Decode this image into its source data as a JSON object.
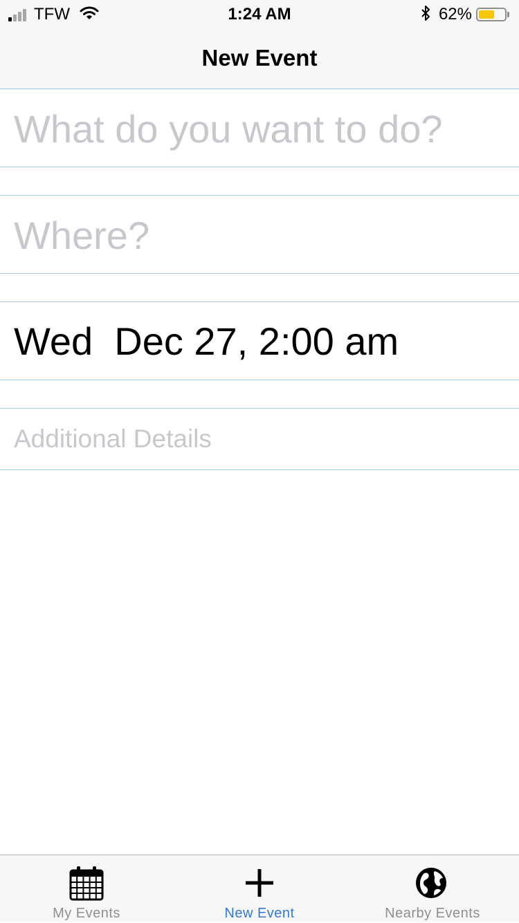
{
  "colors": {
    "accent": "#3478d6",
    "inactive": "#8e8e93",
    "placeholder": "#c7c7cd",
    "separator": "#9fd0e6",
    "battery": "#f6c60d",
    "bars_bg": "#f7f7f7"
  },
  "status_bar": {
    "carrier": "TFW",
    "time": "1:24 AM",
    "battery_percent": "62%",
    "battery_level": 0.62,
    "signal_bars_filled": 1,
    "signal_bars_total": 4,
    "icons": [
      "signal-icon",
      "wifi-icon",
      "bluetooth-icon",
      "battery-icon"
    ]
  },
  "nav": {
    "title": "New Event"
  },
  "form": {
    "what_placeholder": "What do you want to do?",
    "what_value": "",
    "where_placeholder": "Where?",
    "where_value": "",
    "date_value": "Wed  Dec 27, 2:00 am",
    "details_placeholder": "Additional Details",
    "details_value": ""
  },
  "tabs": [
    {
      "label": "My Events",
      "icon": "calendar-icon",
      "active": false
    },
    {
      "label": "New Event",
      "icon": "plus-icon",
      "active": true
    },
    {
      "label": "Nearby Events",
      "icon": "globe-icon",
      "active": false
    }
  ]
}
